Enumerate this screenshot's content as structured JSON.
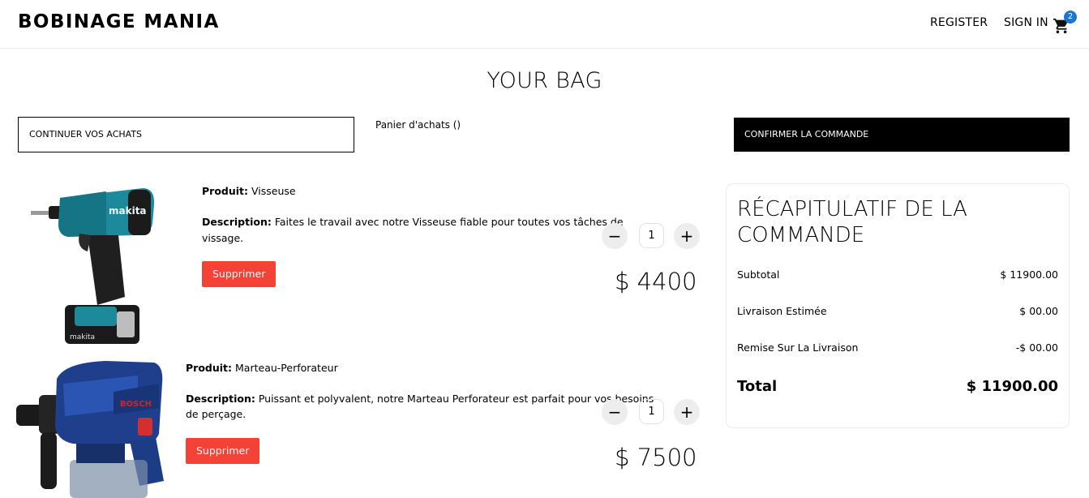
{
  "header": {
    "logo": "BOBINAGE MANIA",
    "register": "REGISTER",
    "sign_in": "SIGN IN",
    "cart_count": "2",
    "cart_icon": "shopping-cart-icon"
  },
  "page": {
    "title": "YOUR BAG",
    "continue_label": "CONTINUER VOS ACHATS",
    "cart_text": "Panier d'achats ()",
    "confirm_label": "CONFIRMER LA COMMANDE"
  },
  "products": [
    {
      "product_label": "Produit:",
      "product_name": "Visseuse",
      "description_label": "Description:",
      "description_line1": "Faites le travail avec notre Visseuse fiable pour toutes vos tâches de",
      "description_line2": "vissage.",
      "delete_label": "Supprimer",
      "quantity": "1",
      "minus": "−",
      "plus": "+",
      "price": "$ 4400"
    },
    {
      "product_label": "Produit:",
      "product_name": "Marteau-Perforateur",
      "description_label": "Description:",
      "description_line1": "Puissant et polyvalent, notre Marteau Perforateur est parfait pour vos besoins",
      "description_line2": "de perçage.",
      "delete_label": "Supprimer",
      "quantity": "1",
      "minus": "−",
      "plus": "+",
      "price": "$ 7500"
    }
  ],
  "summary": {
    "title_line1": "RÉCAPITULATIF DE LA",
    "title_line2": "COMMANDE",
    "subtotal_label": "Subtotal",
    "subtotal_value": "$ 11900.00",
    "shipping_label": "Livraison Estimée",
    "shipping_value": "$ 00.00",
    "discount_label": "Remise Sur La Livraison",
    "discount_value": "-$ 00.00",
    "total_label": "Total",
    "total_value": "$ 11900.00"
  },
  "colors": {
    "delete_button": "#f44336",
    "badge": "#1976d2",
    "confirm_button": "#000000"
  }
}
